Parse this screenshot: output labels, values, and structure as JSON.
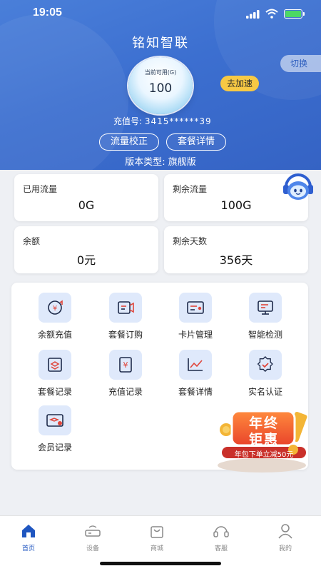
{
  "status_bar": {
    "time": "19:05"
  },
  "header": {
    "app_title": "铭知智联",
    "switch_label": "切换",
    "data_available_label": "当前可用(G)",
    "data_available_value": "100",
    "speed_up_label": "去加速",
    "card_no_label": "充值号:",
    "card_no_value": "3415******39",
    "calibrate_label": "流量校正",
    "plan_detail_label": "套餐详情",
    "version_text": "版本类型:  旗舰版"
  },
  "stats": [
    {
      "label": "已用流量",
      "value": "0G"
    },
    {
      "label": "剩余流量",
      "value": "100G"
    },
    {
      "label": "余额",
      "value": "0元"
    },
    {
      "label": "剩余天数",
      "value": "356天"
    }
  ],
  "grid": [
    {
      "label": "余额充值",
      "icon": "recharge-icon"
    },
    {
      "label": "套餐订购",
      "icon": "plan-order-icon"
    },
    {
      "label": "卡片管理",
      "icon": "card-manage-icon"
    },
    {
      "label": "智能检测",
      "icon": "monitor-icon"
    },
    {
      "label": "套餐记录",
      "icon": "plan-record-icon"
    },
    {
      "label": "充值记录",
      "icon": "recharge-record-icon"
    },
    {
      "label": "套餐详情",
      "icon": "chart-icon"
    },
    {
      "label": "实名认证",
      "icon": "verify-icon"
    },
    {
      "label": "会员记录",
      "icon": "member-icon"
    }
  ],
  "promo": {
    "line1": "年终",
    "line2": "钜惠",
    "line3": "年包下单立减50元"
  },
  "tabs": [
    {
      "label": "首页",
      "icon": "home-icon",
      "active": true
    },
    {
      "label": "设备",
      "icon": "router-icon",
      "active": false
    },
    {
      "label": "商城",
      "icon": "bag-icon",
      "active": false
    },
    {
      "label": "客服",
      "icon": "headset-icon",
      "active": false
    },
    {
      "label": "我的",
      "icon": "user-icon",
      "active": false
    }
  ],
  "colors": {
    "header_blue": "#3c6fd0",
    "accent_yellow": "#f7c944",
    "icon_red": "#e0453a",
    "active_tab": "#1f56c0"
  }
}
